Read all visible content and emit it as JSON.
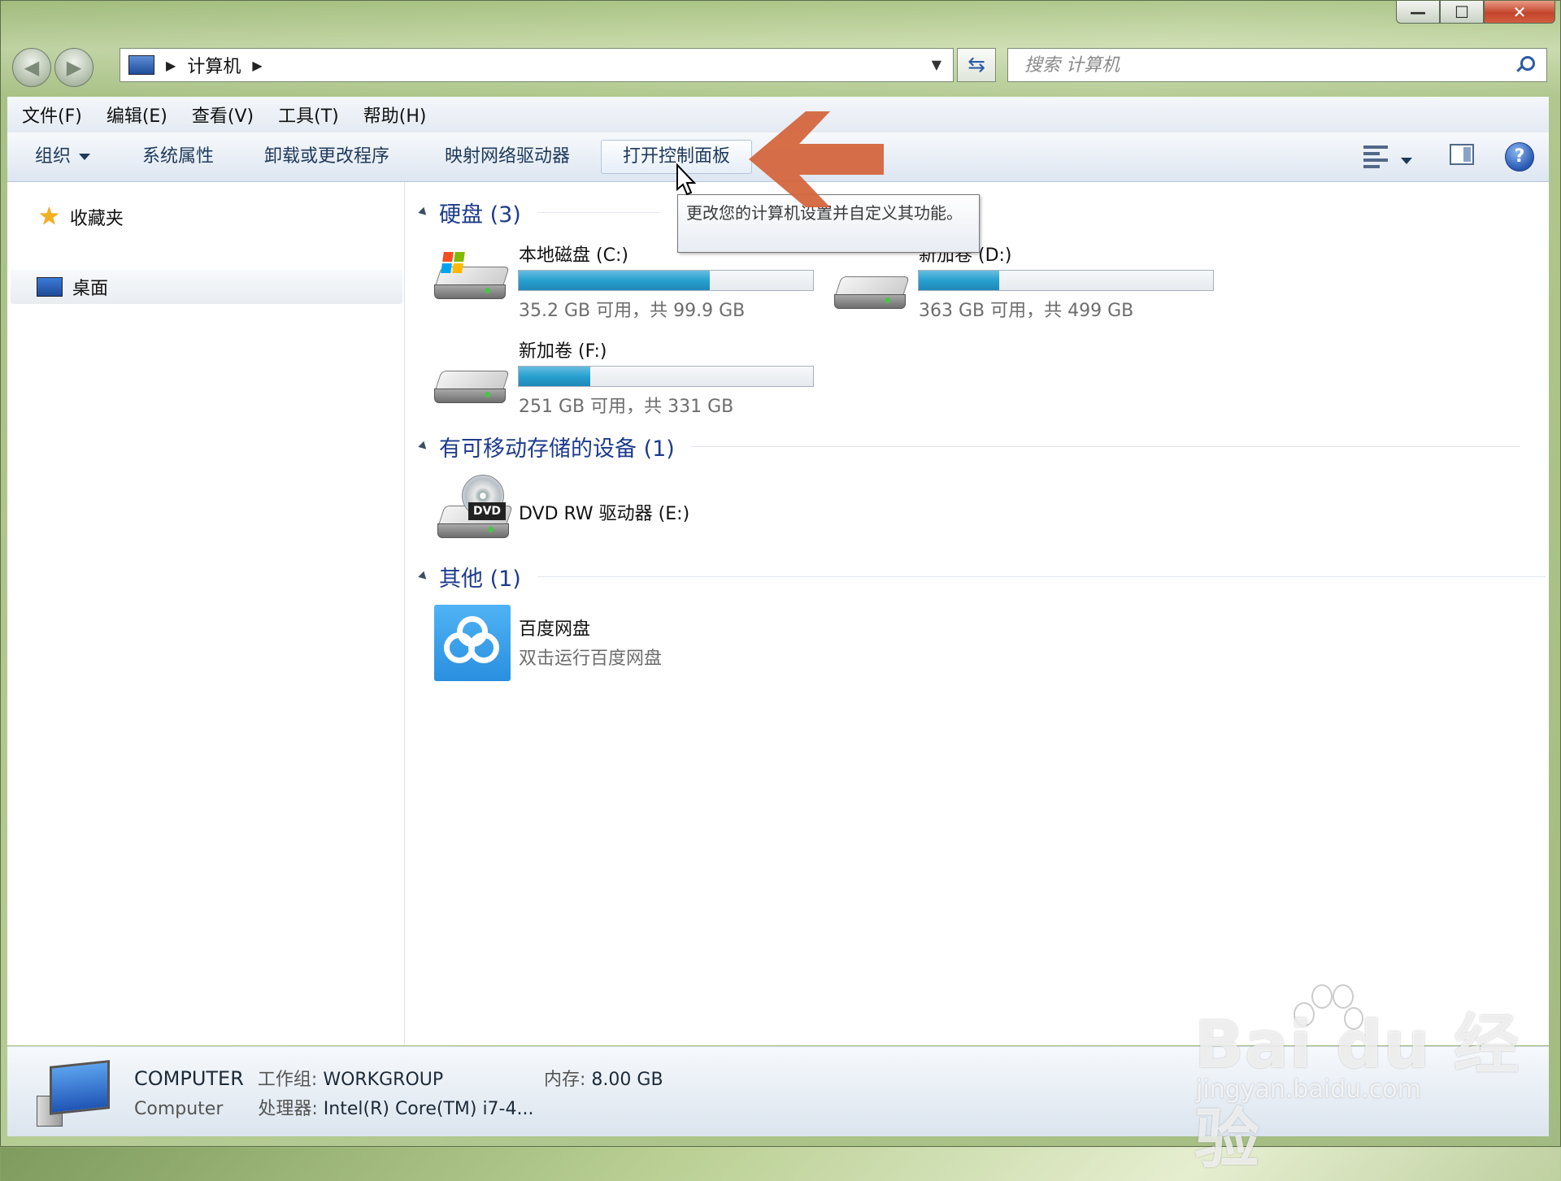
{
  "window": {
    "minimize_label": "—",
    "maximize_label": "☐",
    "close_label": "✕"
  },
  "address_bar": {
    "crumb": "计算机",
    "search_placeholder": "搜索 计算机"
  },
  "menu": [
    "文件(F)",
    "编辑(E)",
    "查看(V)",
    "工具(T)",
    "帮助(H)"
  ],
  "toolbar": {
    "organize": "组织",
    "system_properties": "系统属性",
    "uninstall": "卸载或更改程序",
    "map_drive": "映射网络驱动器",
    "control_panel": "打开控制面板",
    "help": "?"
  },
  "tooltip": "更改您的计算机设置并自定义其功能。",
  "nav": {
    "favorites": "收藏夹",
    "desktop": "桌面"
  },
  "groups": {
    "hard_disks": "硬盘 (3)",
    "removable": "有可移动存储的设备 (1)",
    "other": "其他 (1)"
  },
  "drives": [
    {
      "name": "本地磁盘 (C:)",
      "free": "35.2 GB 可用，共 99.9 GB",
      "used_fraction": 0.648
    },
    {
      "name": "新加卷 (D:)",
      "free": "363 GB 可用，共 499 GB",
      "used_fraction": 0.273
    },
    {
      "name": "新加卷 (F:)",
      "free": "251 GB 可用，共 331 GB",
      "used_fraction": 0.242
    }
  ],
  "dvd": {
    "name": "DVD RW 驱动器 (E:)",
    "badge": "DVD"
  },
  "baidu": {
    "name": "百度网盘",
    "desc": "双击运行百度网盘"
  },
  "details": {
    "computer_name": "COMPUTER",
    "computer_type": "Computer",
    "workgroup_label": "工作组:",
    "workgroup_value": "WORKGROUP",
    "memory_label": "内存:",
    "memory_value": "8.00 GB",
    "cpu_label": "处理器:",
    "cpu_value": "Intel(R) Core(TM) i7-4..."
  },
  "watermark": {
    "brand": "Bai du 经验",
    "url": "jingyan.baidu.com"
  }
}
